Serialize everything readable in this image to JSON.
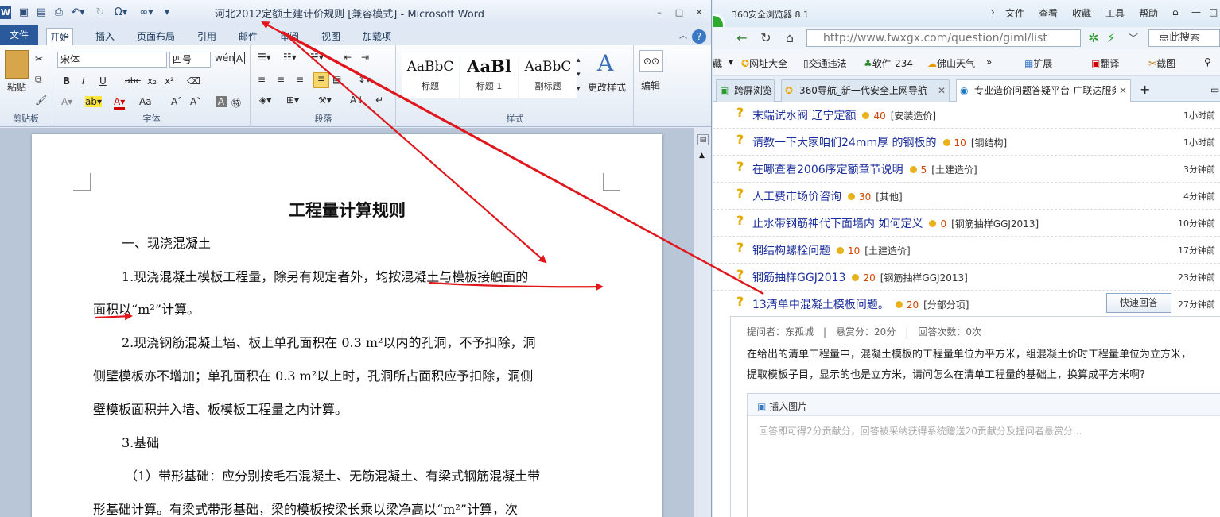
{
  "word": {
    "app_icon": "W",
    "title": "河北2012定额土建计价规则 [兼容模式] - Microsoft Word",
    "qa_icons": [
      "save-icon",
      "open-icon",
      "print-icon",
      "undo-icon",
      "redo-icon",
      "omega-icon",
      "infinity-icon",
      "customize-icon"
    ],
    "tabs": [
      "文件",
      "开始",
      "插入",
      "页面布局",
      "引用",
      "邮件",
      "审阅",
      "视图",
      "加载项"
    ],
    "clipboard": {
      "paste": "粘贴",
      "label": "剪贴板"
    },
    "font": {
      "name": "宋体",
      "size": "四号",
      "bold": "B",
      "italic": "I",
      "underline": "U",
      "strike": "abc",
      "sub": "x₂",
      "sup": "x²",
      "case": "Aa",
      "grow": "A˄",
      "shrink": "A˅",
      "label": "字体"
    },
    "paragraph": {
      "label": "段落"
    },
    "styles": {
      "items": [
        {
          "sample": "AaBbC",
          "name": "标题"
        },
        {
          "sample": "AaBl",
          "name": "标题 1"
        },
        {
          "sample": "AaBbC",
          "name": "副标题"
        }
      ],
      "change": "更改样式",
      "label": "样式"
    },
    "editing": {
      "label": "编辑"
    },
    "document": {
      "heading": "工程量计算规则",
      "lines": [
        "一、现浇混凝土",
        "1.现浇混凝土模板工程量，除另有规定者外，均按混凝土与模板接触面的",
        "面积以“m²”计算。",
        "2.现浇钢筋混凝土墙、板上单孔面积在 0.3 m²以内的孔洞，不予扣除，洞",
        "侧壁模板亦不增加；单孔面积在 0.3 m²以上时，孔洞所占面积应予扣除，洞侧",
        "壁模板面积并入墙、板模板工程量之内计算。",
        "3.基础",
        "（1）带形基础：应分别按毛石混凝土、无筋混凝土、有梁式钢筋混凝土带",
        "形基础计算。有梁式带形基础，梁的模板按梁长乘以梁净高以“m²”计算，次"
      ]
    }
  },
  "browser": {
    "title": "360安全浏览器 8.1",
    "menu": [
      "文件",
      "查看",
      "收藏",
      "工具",
      "帮助"
    ],
    "address": "http://www.fwxgx.com/question/giml/list",
    "search_placeholder": "点此搜索",
    "favorites": [
      "藏",
      "网址大全",
      "交通违法",
      "软件-234",
      "佛山天气",
      "扩展",
      "翻译",
      "截图"
    ],
    "tabs": [
      {
        "label": "跨屏浏览"
      },
      {
        "label": "360导航_新一代安全上网导航"
      },
      {
        "label": "专业造价问题答疑平台-广联达服务新干线"
      }
    ],
    "questions": [
      {
        "title": "末端试水阀 辽宁定额",
        "score": "40",
        "category": "[安装造价]",
        "time": "1小时前"
      },
      {
        "title": "请教一下大家咱们24mm厚 的钢板的",
        "score": "10",
        "category": "[钢结构]",
        "time": "1小时前"
      },
      {
        "title": "在哪查看2006序定额章节说明",
        "score": "5",
        "category": "[土建造价]",
        "time": "3分钟前"
      },
      {
        "title": "人工费市场价咨询",
        "score": "30",
        "category": "[其他]",
        "time": "4分钟前"
      },
      {
        "title": "止水带钢筋神代下面墙内 如何定义",
        "score": "0",
        "category": "[钢筋抽样GGJ2013]",
        "time": "10分钟前"
      },
      {
        "title": "钢结构螺栓问题",
        "score": "10",
        "category": "[土建造价]",
        "time": "17分钟前"
      },
      {
        "title": "钢筋抽样GGJ2013",
        "score": "20",
        "category": "[钢筋抽样GGJ2013]",
        "time": "23分钟前"
      },
      {
        "title": "13清单中混凝土模板问题。",
        "score": "20",
        "category": "[分部分项]",
        "time": "27分钟前"
      }
    ],
    "quick_answer": "快速回答",
    "detail": {
      "meta": "提问者：东孤城　|　悬赏分：20分　|　回答次数：0次",
      "line1": "在给出的清单工程量中，混凝土模板的工程量单位为平方米，组混凝土价时工程量单位为立方米，",
      "line2": "提取模板子目，显示的也是立方米，请问怎么在清单工程量的基础上，换算成平方米啊?",
      "insert_image": "插入图片",
      "answer_placeholder": "回答即可得2分贡献分，回答被采纳获得系统赠送20贡献分及提问者悬赏分..."
    }
  },
  "annotation_color": "#e0171d"
}
